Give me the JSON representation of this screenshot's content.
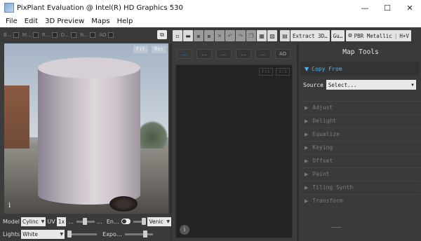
{
  "window": {
    "title": "PixPlant Evaluation @ Intel(R) HD Graphics 530",
    "minimize": "—",
    "maximize": "☐",
    "close": "✕"
  },
  "menu": [
    "File",
    "Edit",
    "3D Preview",
    "Maps",
    "Help"
  ],
  "viewport_toolbar": {
    "items": [
      "B…",
      "M…",
      "R…",
      "D…",
      "N…",
      "AO"
    ]
  },
  "main_toolbar": {
    "extract_label": "Extract 3D…",
    "gu_label": "Gu…",
    "pbr_label": "PBR Metallic",
    "hv_label": "H+V"
  },
  "viewport": {
    "fit_label": "Fit",
    "res_label": "Res",
    "info": "i"
  },
  "bottom_controls": {
    "model_label": "Model",
    "model_value": "Cylinc",
    "uv_label": "UV",
    "uv_value": "1x",
    "uv_more": "…",
    "en_label": "En…",
    "env_value": "Venic",
    "lights_label": "Lights",
    "lights_value": "White",
    "expo_label": "Expo…"
  },
  "center": {
    "tabs": [
      "…",
      "…",
      "…",
      "…",
      "…",
      "AO"
    ],
    "fit_label": "Fit",
    "ratio_label": "1:1",
    "info": "i"
  },
  "map_tools": {
    "title": "Map Tools",
    "open_section": "Copy From",
    "source_label": "Source",
    "source_value": "Select...",
    "sections": [
      "Adjust",
      "Delight",
      "Equalize",
      "Keying",
      "Offset",
      "Paint",
      "Tiling Synth",
      "Transform"
    ]
  },
  "colors": {
    "accent": "#4fb3ff",
    "panel_bg": "#3a3a3a",
    "canvas_bg": "#232323"
  }
}
